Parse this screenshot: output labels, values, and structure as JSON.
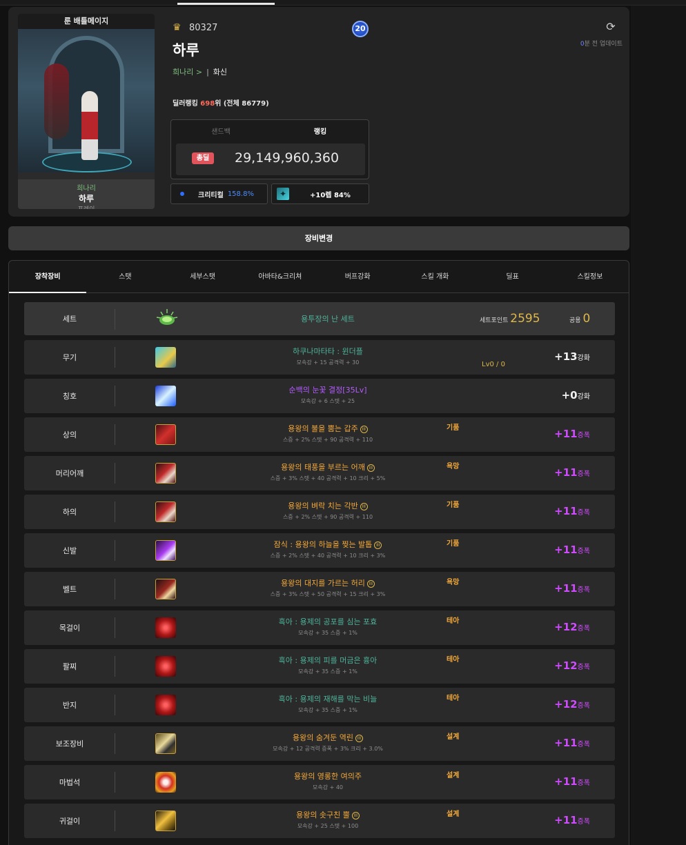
{
  "profile": {
    "server": "룬 배틀메이지",
    "adventure": "희나리",
    "name": "하루",
    "class": "프레이",
    "fame": "80327",
    "level_badge": "20",
    "job_adventure": "희나리 >",
    "job_sep": "|",
    "job": "화신",
    "rank_prefix": "딜러랭킹 ",
    "rank_value": "698",
    "rank_suffix": "위 (전체 86779)",
    "updated_num": "0",
    "updated_text": "분 전 업데이트"
  },
  "damage": {
    "tab_sandbag": "샌드백",
    "tab_ranking": "랭킹",
    "badge": "총딜",
    "value": "29,149,960,360"
  },
  "substats": {
    "crit_label": "크리티컬",
    "crit_value": "158.8%",
    "skill_value": "+10렙 84%"
  },
  "equip_button": "장비변경",
  "tabs": [
    "장착장비",
    "스탯",
    "세부스탯",
    "아바타&크리쳐",
    "버프강화",
    "스킬 개화",
    "딜표",
    "스킬정보"
  ],
  "set_row": {
    "slot": "세트",
    "name": "용투장의 난 세트",
    "points_label": "세트포인트",
    "points": "2595",
    "common_label": "공용",
    "common": "0"
  },
  "items": [
    {
      "slot": "무기",
      "name": "하쿠나마타타 : 윈더플",
      "stat": "모속강 + 15 공격력 + 30",
      "tag": "",
      "lv": "Lv0 / 0",
      "reinf": "+13",
      "reinf_label": "강화"
    },
    {
      "slot": "칭호",
      "name": "순백의 눈꽃 결정[35Lv]",
      "stat": "모속강 + 6 스텟 + 25",
      "tag": "",
      "lv": "",
      "reinf": "+0",
      "reinf_label": "강화"
    },
    {
      "slot": "상의",
      "name": "용왕의 불을 뿜는 갑주",
      "stat": "스증 + 2% 스텟 + 90 공격력 + 110",
      "tag": "기품",
      "lv": "",
      "reinf": "+11",
      "reinf_label": "증폭"
    },
    {
      "slot": "머리어깨",
      "name": "용왕의 태풍을 부르는 어깨",
      "stat": "스증 + 3% 스텟 + 40 공격력 + 10 크리 + 5%",
      "tag": "욕망",
      "lv": "",
      "reinf": "+11",
      "reinf_label": "증폭"
    },
    {
      "slot": "하의",
      "name": "용왕의 벼락 치는 각반",
      "stat": "스증 + 2% 스텟 + 90 공격력 + 110",
      "tag": "기품",
      "lv": "",
      "reinf": "+11",
      "reinf_label": "증폭"
    },
    {
      "slot": "신발",
      "name": "잠식 : 용왕의 하늘을 찢는 발톱",
      "stat": "스증 + 2% 스텟 + 40 공격력 + 10 크리 + 3%",
      "tag": "기품",
      "lv": "",
      "reinf": "+11",
      "reinf_label": "증폭"
    },
    {
      "slot": "벨트",
      "name": "용왕의 대지를 가르는 허리",
      "stat": "스증 + 3% 스텟 + 50 공격력 + 15 크리 + 3%",
      "tag": "욕망",
      "lv": "",
      "reinf": "+11",
      "reinf_label": "증폭"
    },
    {
      "slot": "목걸이",
      "name": "흑아 : 용제의 공포를 심는 포효",
      "stat": "모속강 + 35 스증 + 1%",
      "tag": "테아",
      "lv": "",
      "reinf": "+12",
      "reinf_label": "증폭"
    },
    {
      "slot": "팔찌",
      "name": "흑아 : 용제의 피를 머금은 흉아",
      "stat": "모속강 + 35 스증 + 1%",
      "tag": "테아",
      "lv": "",
      "reinf": "+12",
      "reinf_label": "증폭"
    },
    {
      "slot": "반지",
      "name": "흑아 : 용제의 재해를 막는 비늘",
      "stat": "모속강 + 35 스증 + 1%",
      "tag": "테아",
      "lv": "",
      "reinf": "+12",
      "reinf_label": "증폭"
    },
    {
      "slot": "보조장비",
      "name": "용왕의 숨겨둔 역린",
      "stat": "모속강 + 12 공격력 증폭 + 3% 크리 + 3.0%",
      "tag": "설계",
      "lv": "",
      "reinf": "+11",
      "reinf_label": "증폭"
    },
    {
      "slot": "마법석",
      "name": "용왕의 영롱한 여의주",
      "stat": "모속강 + 40",
      "tag": "설계",
      "lv": "",
      "reinf": "+11",
      "reinf_label": "증폭"
    },
    {
      "slot": "귀걸이",
      "name": "용왕의 솟구친 뿔",
      "stat": "모속강 + 25 스텟 + 100",
      "tag": "설계",
      "lv": "",
      "reinf": "+11",
      "reinf_label": "증폭"
    }
  ],
  "tier_mark": "III",
  "icons": {
    "fame": "crest-icon",
    "refresh": "refresh-icon",
    "skill": "skill-icon",
    "crit_dot": "blue-dot-icon"
  },
  "colors": {
    "accent_gold": "#e0b84a",
    "rank_red": "#ff6a5c",
    "crit_blue": "#4c8dff",
    "amp_purple": "#d04bff",
    "set_green": "#4fb39a",
    "epic_orange": "#f2a93b"
  }
}
